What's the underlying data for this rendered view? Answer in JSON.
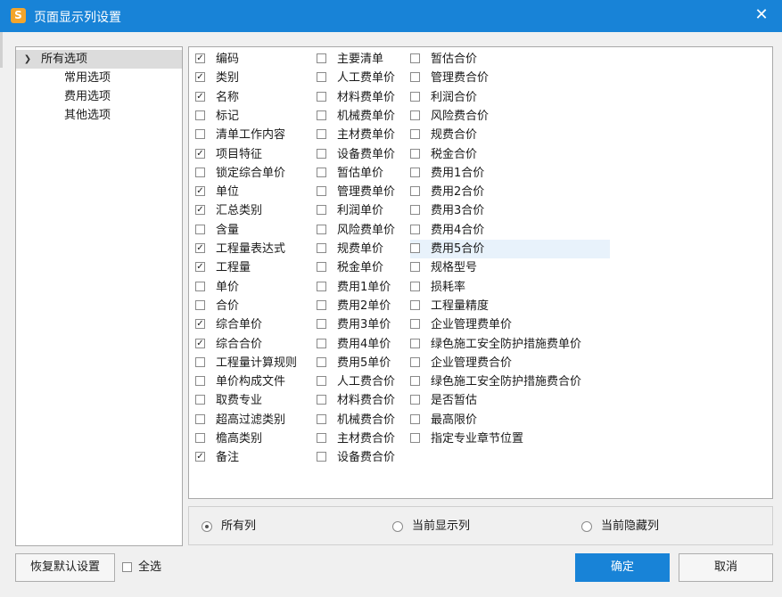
{
  "dialog": {
    "title": "页面显示列设置",
    "close_glyph": "✕",
    "app_icon_glyph": "S"
  },
  "tree": {
    "root": {
      "label": "所有选项",
      "expanded": true
    },
    "children": [
      "常用选项",
      "费用选项",
      "其他选项"
    ]
  },
  "columns": [
    [
      {
        "label": "编码",
        "checked": true
      },
      {
        "label": "类别",
        "checked": true
      },
      {
        "label": "名称",
        "checked": true
      },
      {
        "label": "标记",
        "checked": false
      },
      {
        "label": "清单工作内容",
        "checked": false
      },
      {
        "label": "项目特征",
        "checked": true
      },
      {
        "label": "锁定综合单价",
        "checked": false
      },
      {
        "label": "单位",
        "checked": true
      },
      {
        "label": "汇总类别",
        "checked": true
      },
      {
        "label": "含量",
        "checked": false
      },
      {
        "label": "工程量表达式",
        "checked": true
      },
      {
        "label": "工程量",
        "checked": true
      },
      {
        "label": "单价",
        "checked": false
      },
      {
        "label": "合价",
        "checked": false
      },
      {
        "label": "综合单价",
        "checked": true
      },
      {
        "label": "综合合价",
        "checked": true
      },
      {
        "label": "工程量计算规则",
        "checked": false
      },
      {
        "label": "单价构成文件",
        "checked": false
      },
      {
        "label": "取费专业",
        "checked": false
      },
      {
        "label": "超高过滤类别",
        "checked": false
      },
      {
        "label": "檐高类别",
        "checked": false
      },
      {
        "label": "备注",
        "checked": true
      }
    ],
    [
      {
        "label": "主要清单",
        "checked": false
      },
      {
        "label": "人工费单价",
        "checked": false
      },
      {
        "label": "材料费单价",
        "checked": false
      },
      {
        "label": "机械费单价",
        "checked": false
      },
      {
        "label": "主材费单价",
        "checked": false
      },
      {
        "label": "设备费单价",
        "checked": false
      },
      {
        "label": "暂估单价",
        "checked": false
      },
      {
        "label": "管理费单价",
        "checked": false
      },
      {
        "label": "利润单价",
        "checked": false
      },
      {
        "label": "风险费单价",
        "checked": false
      },
      {
        "label": "规费单价",
        "checked": false
      },
      {
        "label": "税金单价",
        "checked": false
      },
      {
        "label": "费用1单价",
        "checked": false
      },
      {
        "label": "费用2单价",
        "checked": false
      },
      {
        "label": "费用3单价",
        "checked": false
      },
      {
        "label": "费用4单价",
        "checked": false
      },
      {
        "label": "费用5单价",
        "checked": false
      },
      {
        "label": "人工费合价",
        "checked": false
      },
      {
        "label": "材料费合价",
        "checked": false
      },
      {
        "label": "机械费合价",
        "checked": false
      },
      {
        "label": "主材费合价",
        "checked": false
      },
      {
        "label": "设备费合价",
        "checked": false
      }
    ],
    [
      {
        "label": "暂估合价",
        "checked": false
      },
      {
        "label": "管理费合价",
        "checked": false
      },
      {
        "label": "利润合价",
        "checked": false
      },
      {
        "label": "风险费合价",
        "checked": false
      },
      {
        "label": "规费合价",
        "checked": false
      },
      {
        "label": "税金合价",
        "checked": false
      },
      {
        "label": "费用1合价",
        "checked": false
      },
      {
        "label": "费用2合价",
        "checked": false
      },
      {
        "label": "费用3合价",
        "checked": false
      },
      {
        "label": "费用4合价",
        "checked": false
      },
      {
        "label": "费用5合价",
        "checked": false,
        "highlighted": true
      },
      {
        "label": "规格型号",
        "checked": false
      },
      {
        "label": "损耗率",
        "checked": false
      },
      {
        "label": "工程量精度",
        "checked": false
      },
      {
        "label": "企业管理费单价",
        "checked": false
      },
      {
        "label": "绿色施工安全防护措施费单价",
        "checked": false
      },
      {
        "label": "企业管理费合价",
        "checked": false
      },
      {
        "label": "绿色施工安全防护措施费合价",
        "checked": false
      },
      {
        "label": "是否暂估",
        "checked": false
      },
      {
        "label": "最高限价",
        "checked": false
      },
      {
        "label": "指定专业章节位置",
        "checked": false
      }
    ]
  ],
  "filter": {
    "options": [
      "所有列",
      "当前显示列",
      "当前隐藏列"
    ],
    "selected_index": 0
  },
  "footer": {
    "restore_label": "恢复默认设置",
    "select_all_label": "全选",
    "select_all_checked": false,
    "ok_label": "确定",
    "cancel_label": "取消"
  },
  "colors": {
    "accent": "#1883d7",
    "highlight_row": "#e8f2fb"
  }
}
